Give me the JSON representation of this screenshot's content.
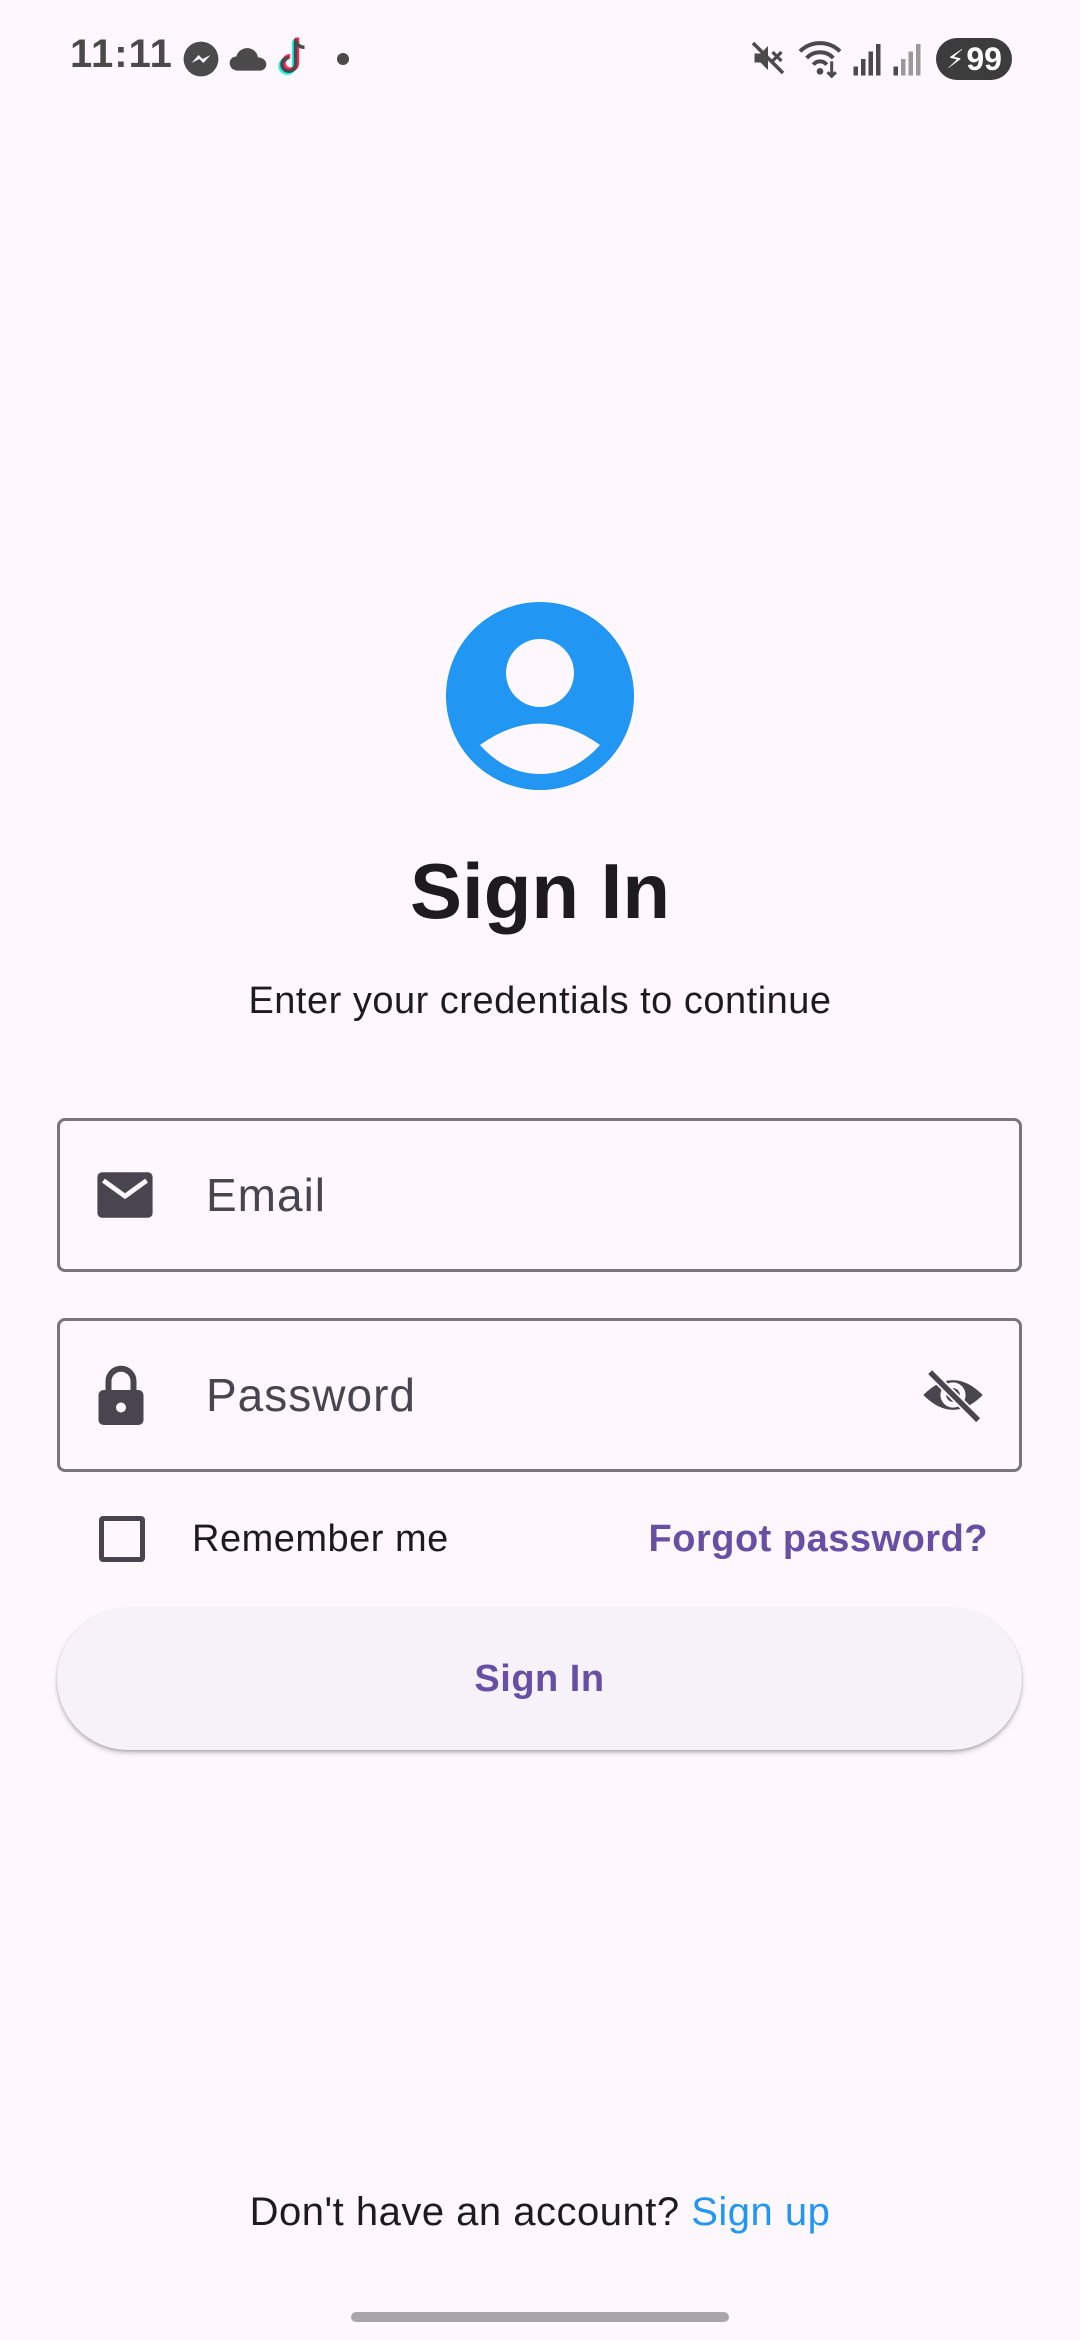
{
  "status_bar": {
    "time": "11:11",
    "battery_level": "99",
    "icons": [
      "messenger-icon",
      "cloud-icon",
      "tiktok-icon",
      "dot-icon",
      "mute-icon",
      "wifi-icon",
      "signal-icon",
      "signal-icon",
      "battery-charging-icon"
    ]
  },
  "header": {
    "avatar_icon": "account-circle-icon",
    "title": "Sign In",
    "subtitle": "Enter your credentials to continue"
  },
  "form": {
    "email": {
      "icon": "mail-icon",
      "placeholder": "Email",
      "value": ""
    },
    "password": {
      "icon": "lock-icon",
      "placeholder": "Password",
      "value": "",
      "toggle_icon": "visibility-off-icon"
    },
    "remember_me": {
      "label": "Remember me",
      "checked": false
    },
    "forgot_password_label": "Forgot password?",
    "submit_label": "Sign In"
  },
  "footer": {
    "prompt": "Don't have an account?",
    "signup_label": "Sign up"
  },
  "colors": {
    "background": "#FEF7FE",
    "primary": "#6750A4",
    "avatar_blue": "#2196F3",
    "link_blue": "#2196F3",
    "outline": "#79747E",
    "text": "#1D1B20"
  }
}
